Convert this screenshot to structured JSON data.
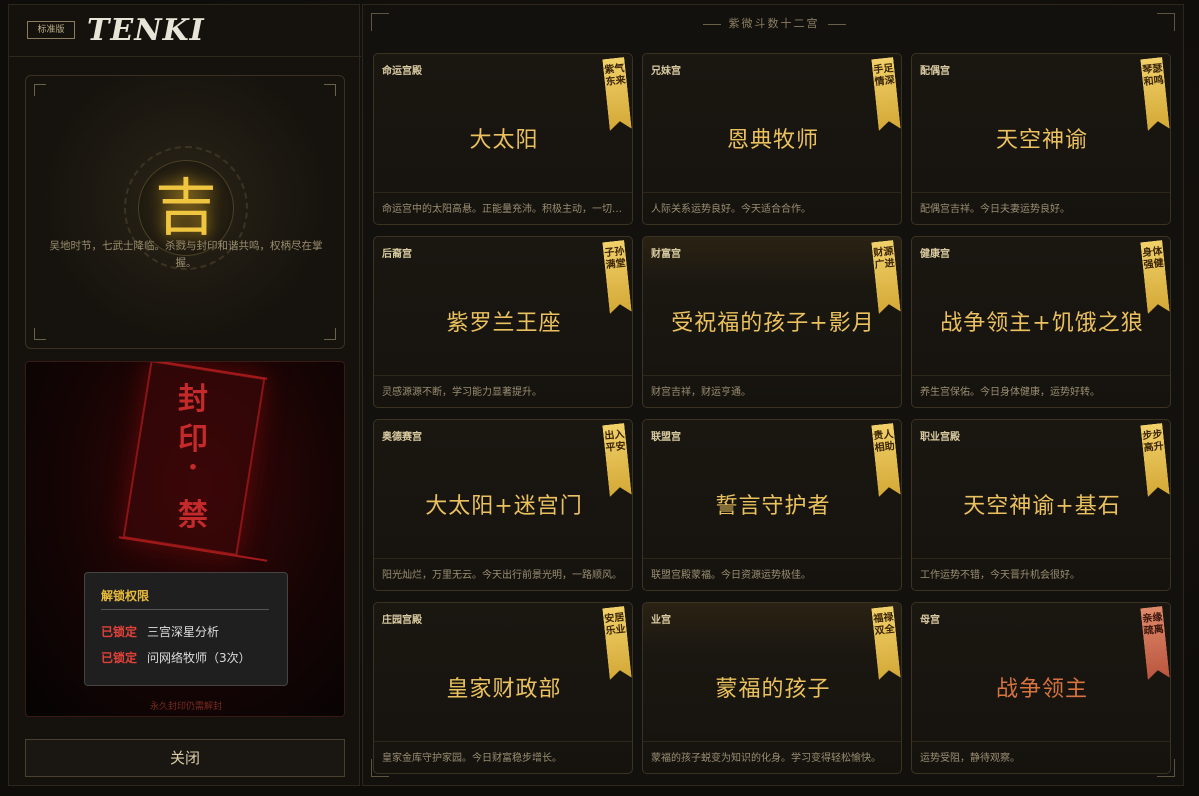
{
  "header": {
    "edition_tag": "标准版",
    "logo_text": "TENKI"
  },
  "fortune": {
    "symbol": "吉",
    "text": "吴地时节，七武士降临。杀戮与封印和谐共鸣，权柄尽在掌握。"
  },
  "seal": {
    "chars": [
      "封",
      "印",
      "·",
      "禁"
    ],
    "bottom_text": "永久封印仍需解封",
    "unlock": {
      "title": "解锁权限",
      "items": [
        {
          "status": "已锁定",
          "label": "三宫深星分析"
        },
        {
          "status": "已锁定",
          "label": "问网络牧师（3次）"
        }
      ]
    }
  },
  "close_label": "关闭",
  "palace_panel": {
    "title": "紫微斗数十二宫",
    "cards": [
      {
        "label": "命运宫殿",
        "name": "大太阳",
        "ribbon": "紫气东来",
        "desc": "命运宫中的太阳高悬。正能量充沛。积极主动，一切顺遂。",
        "tone": "gold"
      },
      {
        "label": "兄妹宫",
        "name": "恩典牧师",
        "ribbon": "手足情深",
        "desc": "人际关系运势良好。今天适合合作。",
        "tone": "gold"
      },
      {
        "label": "配偶宫",
        "name": "天空神谕",
        "ribbon": "琴瑟和鸣",
        "desc": "配偶宫吉祥。今日夫妻运势良好。",
        "tone": "gold"
      },
      {
        "label": "后裔宫",
        "name": "紫罗兰王座",
        "ribbon": "子孙满堂",
        "desc": "灵感源源不断，学习能力显著提升。",
        "tone": "gold"
      },
      {
        "label": "财富宫",
        "name": "受祝福的孩子+影月",
        "ribbon": "财源广进",
        "desc": "财宫吉祥，财运亨通。",
        "tone": "gold"
      },
      {
        "label": "健康宫",
        "name": "战争领主+饥饿之狼",
        "ribbon": "身体强健",
        "desc": "养生宫保佑。今日身体健康，运势好转。",
        "tone": "gold"
      },
      {
        "label": "奥德赛宫",
        "name": "大太阳+迷宫门",
        "ribbon": "出入平安",
        "desc": "阳光灿烂，万里无云。今天出行前景光明，一路顺风。",
        "tone": "gold"
      },
      {
        "label": "联盟宫",
        "name": "誓言守护者",
        "ribbon": "贵人相助",
        "desc": "联盟宫殿蒙福。今日资源运势极佳。",
        "tone": "gold"
      },
      {
        "label": "职业宫殿",
        "name": "天空神谕+基石",
        "ribbon": "步步高升",
        "desc": "工作运势不错，今天晋升机会很好。",
        "tone": "gold"
      },
      {
        "label": "庄园宫殿",
        "name": "皇家财政部",
        "ribbon": "安居乐业",
        "desc": "皇家金库守护家园。今日财富稳步增长。",
        "tone": "gold"
      },
      {
        "label": "业宫",
        "name": "蒙福的孩子",
        "ribbon": "福禄双全",
        "desc": "蒙福的孩子蜕变为知识的化身。学习变得轻松愉快。",
        "tone": "gold"
      },
      {
        "label": "母宫",
        "name": "战争领主",
        "ribbon": "亲缘疏离",
        "desc": "运势受阻，静待观察。",
        "tone": "red"
      }
    ]
  },
  "colors": {
    "gold": "#eac15e",
    "red_text": "#d6733e",
    "locked": "#e2413a",
    "accent": "#e8b93a"
  }
}
